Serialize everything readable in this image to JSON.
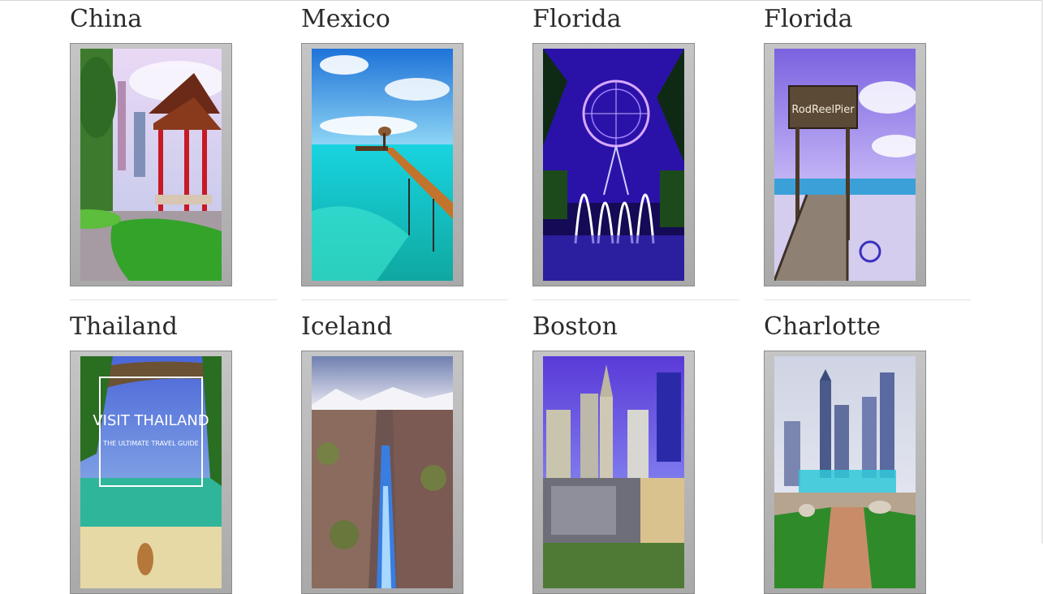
{
  "destinations": [
    {
      "title": "China",
      "image": "chinese-pavilion-garden-photo"
    },
    {
      "title": "Mexico",
      "image": "turquoise-sea-pier-photo"
    },
    {
      "title": "Florida",
      "image": "ferris-wheel-fountain-night-photo"
    },
    {
      "title": "Florida",
      "image": "rod-reel-pier-beach-photo"
    },
    {
      "title": "Thailand",
      "image": "visit-thailand-beach-poster"
    },
    {
      "title": "Iceland",
      "image": "icelandic-canyon-river-photo"
    },
    {
      "title": "Boston",
      "image": "boston-skyline-photo"
    },
    {
      "title": "Charlotte",
      "image": "charlotte-skyline-park-photo"
    }
  ],
  "poster": {
    "pier_sign": "RodReelPier",
    "thailand_heading": "VISIT THAILAND",
    "thailand_sub": "THE ULTIMATE TRAVEL GUIDE"
  }
}
